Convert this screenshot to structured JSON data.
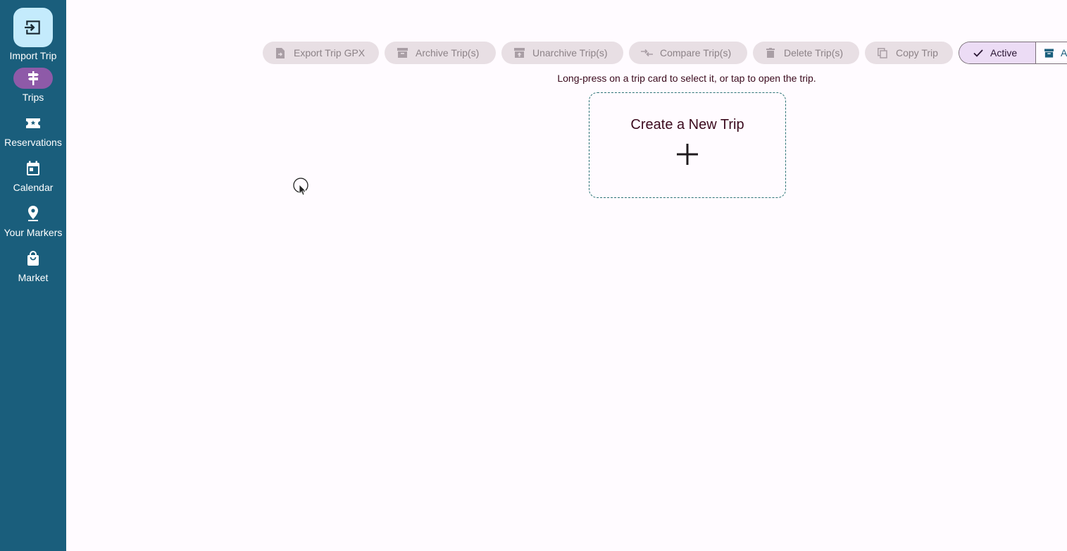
{
  "rail": {
    "items": [
      {
        "label": "Import Trip",
        "icon": "import-icon"
      },
      {
        "label": "Trips",
        "icon": "signpost-icon"
      },
      {
        "label": "Reservations",
        "icon": "ticket-icon"
      },
      {
        "label": "Calendar",
        "icon": "calendar-icon"
      },
      {
        "label": "Your Markers",
        "icon": "map-marker-icon"
      },
      {
        "label": "Market",
        "icon": "shopping-bag-icon"
      }
    ]
  },
  "toolbar": {
    "export_gpx": "Export Trip GPX",
    "archive": "Archive Trip(s)",
    "unarchive": "Unarchive Trip(s)",
    "compare": "Compare Trip(s)",
    "delete": "Delete Trip(s)",
    "copy": "Copy Trip"
  },
  "filter": {
    "active": "Active",
    "archived_partial": "A"
  },
  "main": {
    "hint": "Long-press on a trip card to select it, or tap to open the trip.",
    "create_card_title": "Create a New Trip"
  },
  "colors": {
    "rail_bg": "#1a5e7c",
    "accent_purple": "#8e5aa8",
    "fab_bg": "#c4ebfc",
    "card_border": "#2d7377"
  }
}
